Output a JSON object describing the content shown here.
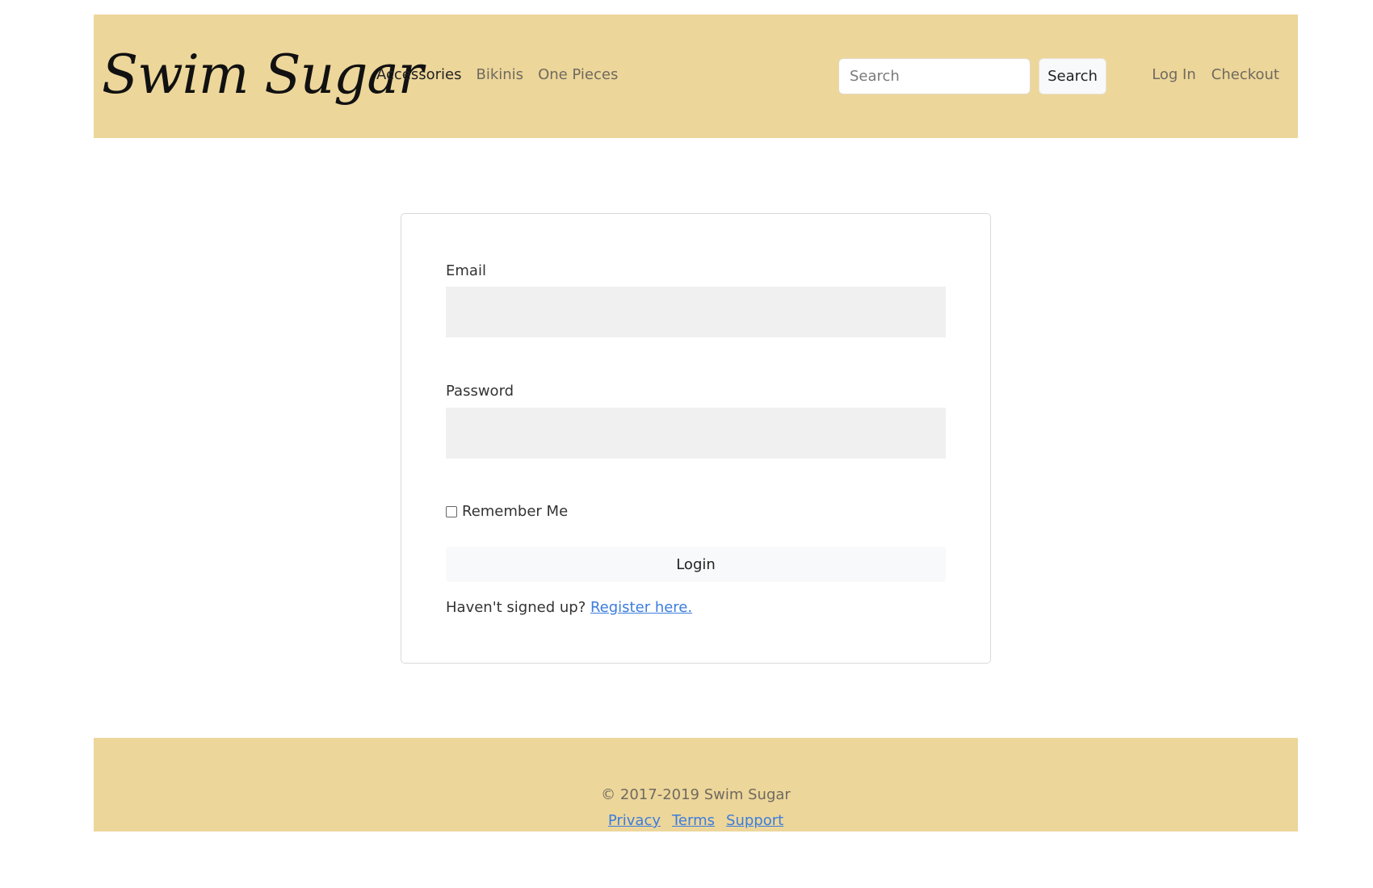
{
  "navbar": {
    "brand": "Swim Sugar",
    "links": [
      {
        "label": "Accessories",
        "active": true
      },
      {
        "label": "Bikinis",
        "active": false
      },
      {
        "label": "One Pieces",
        "active": false
      }
    ],
    "search": {
      "placeholder": "Search",
      "value": "",
      "button_label": "Search"
    },
    "user_links": [
      {
        "label": "Log In"
      },
      {
        "label": "Checkout"
      }
    ]
  },
  "login_form": {
    "email_label": "Email",
    "email_value": "",
    "password_label": "Password",
    "password_value": "",
    "remember_label": "Remember Me",
    "remember_checked": false,
    "login_button_label": "Login",
    "register_prompt": "Haven't signed up?",
    "register_link": "Register here."
  },
  "footer": {
    "copyright": "© 2017-2019 Swim Sugar",
    "links": [
      {
        "label": "Privacy"
      },
      {
        "label": "Terms"
      },
      {
        "label": "Support"
      }
    ]
  },
  "colors": {
    "brand_bar": "#edd69a",
    "link": "#3b7ddd",
    "input_bg": "#f0f0f0"
  }
}
